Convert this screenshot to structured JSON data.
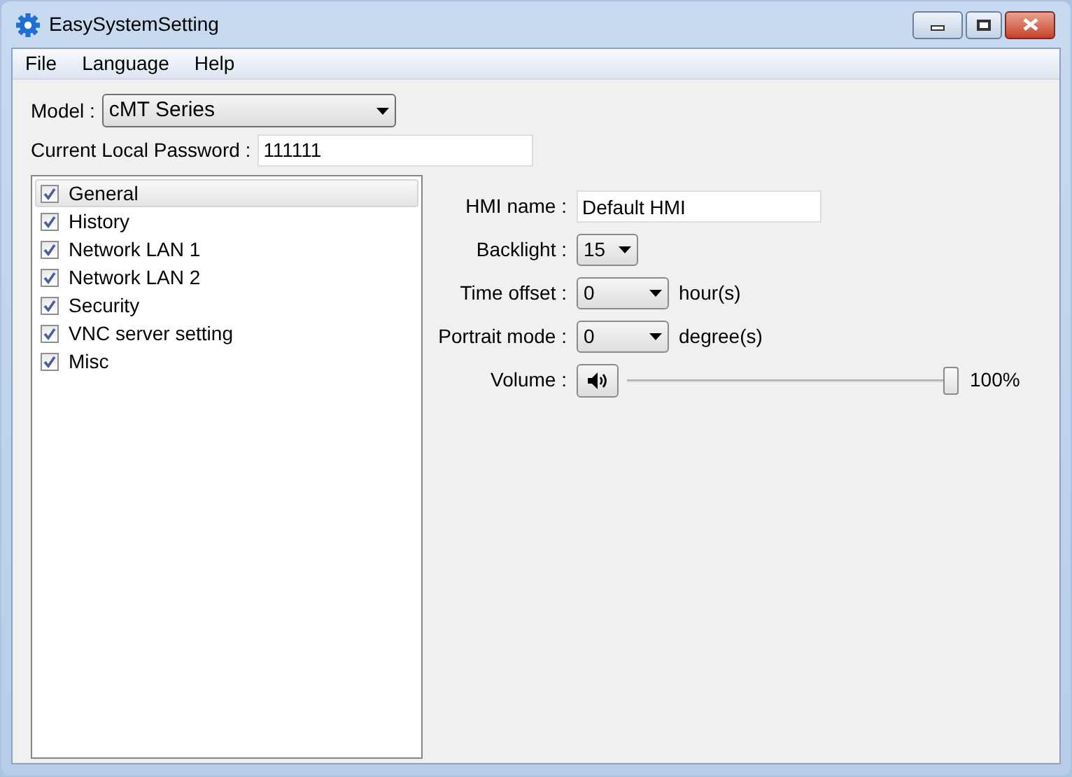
{
  "window": {
    "title": "EasySystemSetting"
  },
  "menu": [
    "File",
    "Language",
    "Help"
  ],
  "model": {
    "label": "Model :",
    "value": "cMT Series"
  },
  "password": {
    "label": "Current Local Password :",
    "value": "111111"
  },
  "categories": [
    {
      "label": "General",
      "checked": true,
      "selected": true
    },
    {
      "label": "History",
      "checked": true,
      "selected": false
    },
    {
      "label": "Network LAN 1",
      "checked": true,
      "selected": false
    },
    {
      "label": "Network LAN 2",
      "checked": true,
      "selected": false
    },
    {
      "label": "Security",
      "checked": true,
      "selected": false
    },
    {
      "label": "VNC server setting",
      "checked": true,
      "selected": false
    },
    {
      "label": "Misc",
      "checked": true,
      "selected": false
    }
  ],
  "settings": [
    {
      "kind": "text",
      "label": "HMI name :",
      "value": "Default HMI"
    },
    {
      "kind": "dropdown",
      "label": "Backlight :",
      "value": "15"
    },
    {
      "kind": "dropdown",
      "label": "Time offset :",
      "value": "0",
      "unit": "hour(s)"
    },
    {
      "kind": "dropdown",
      "label": "Portrait mode :",
      "value": "0",
      "unit": "degree(s)"
    },
    {
      "kind": "slider",
      "label": "Volume :",
      "level": 1.0,
      "reading": "100%"
    }
  ]
}
